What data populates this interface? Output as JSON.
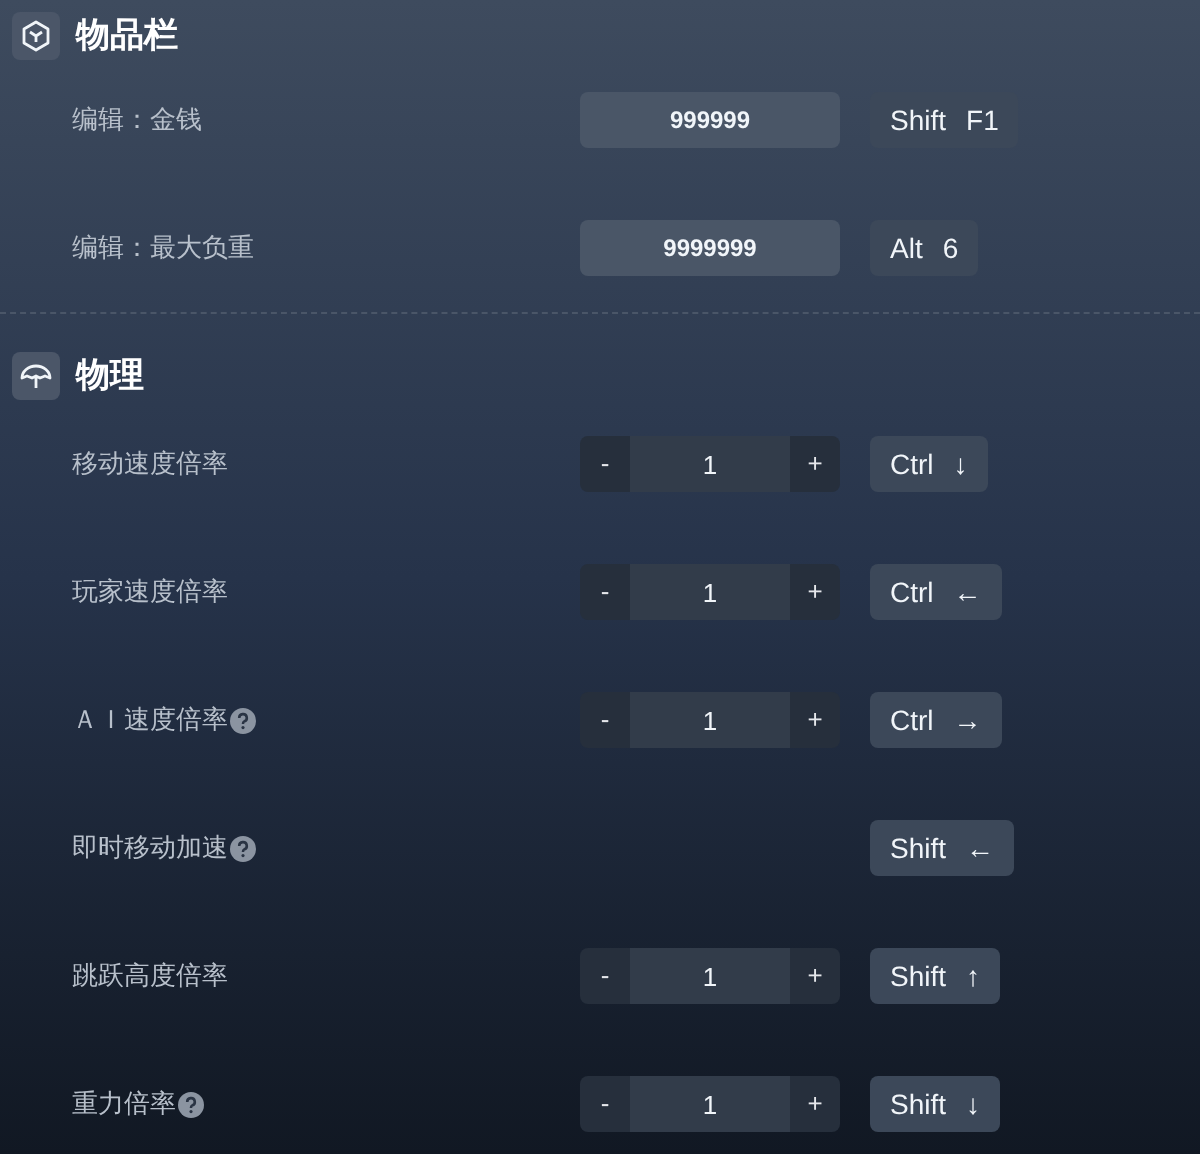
{
  "sections": [
    {
      "title": "物品栏",
      "rows": [
        {
          "label": "编辑：金钱",
          "help": false,
          "kind": "text_input",
          "value": "999999",
          "hotkey": [
            "Shift",
            "F1"
          ]
        },
        {
          "label": "编辑：最大负重",
          "help": false,
          "kind": "text_input",
          "value": "9999999",
          "hotkey": [
            "Alt",
            "6"
          ]
        }
      ]
    },
    {
      "title": "物理",
      "rows": [
        {
          "label": "移动速度倍率",
          "help": false,
          "kind": "stepper",
          "minus": "-",
          "value": "1",
          "plus": "+",
          "hotkey": [
            "Ctrl",
            "↓"
          ]
        },
        {
          "label": "玩家速度倍率",
          "help": false,
          "kind": "stepper",
          "minus": "-",
          "value": "1",
          "plus": "+",
          "hotkey": [
            "Ctrl",
            "←"
          ]
        },
        {
          "label": "ＡＩ速度倍率",
          "help": true,
          "kind": "stepper",
          "minus": "-",
          "value": "1",
          "plus": "+",
          "hotkey": [
            "Ctrl",
            "→"
          ]
        },
        {
          "label": "即时移动加速",
          "help": true,
          "kind": "toggle",
          "hotkey": [
            "Shift",
            "←"
          ]
        },
        {
          "label": "跳跃高度倍率",
          "help": false,
          "kind": "stepper",
          "minus": "-",
          "value": "1",
          "plus": "+",
          "hotkey": [
            "Shift",
            "↑"
          ]
        },
        {
          "label": "重力倍率",
          "help": true,
          "kind": "stepper",
          "minus": "-",
          "value": "1",
          "plus": "+",
          "hotkey": [
            "Shift",
            "↓"
          ]
        }
      ]
    }
  ]
}
